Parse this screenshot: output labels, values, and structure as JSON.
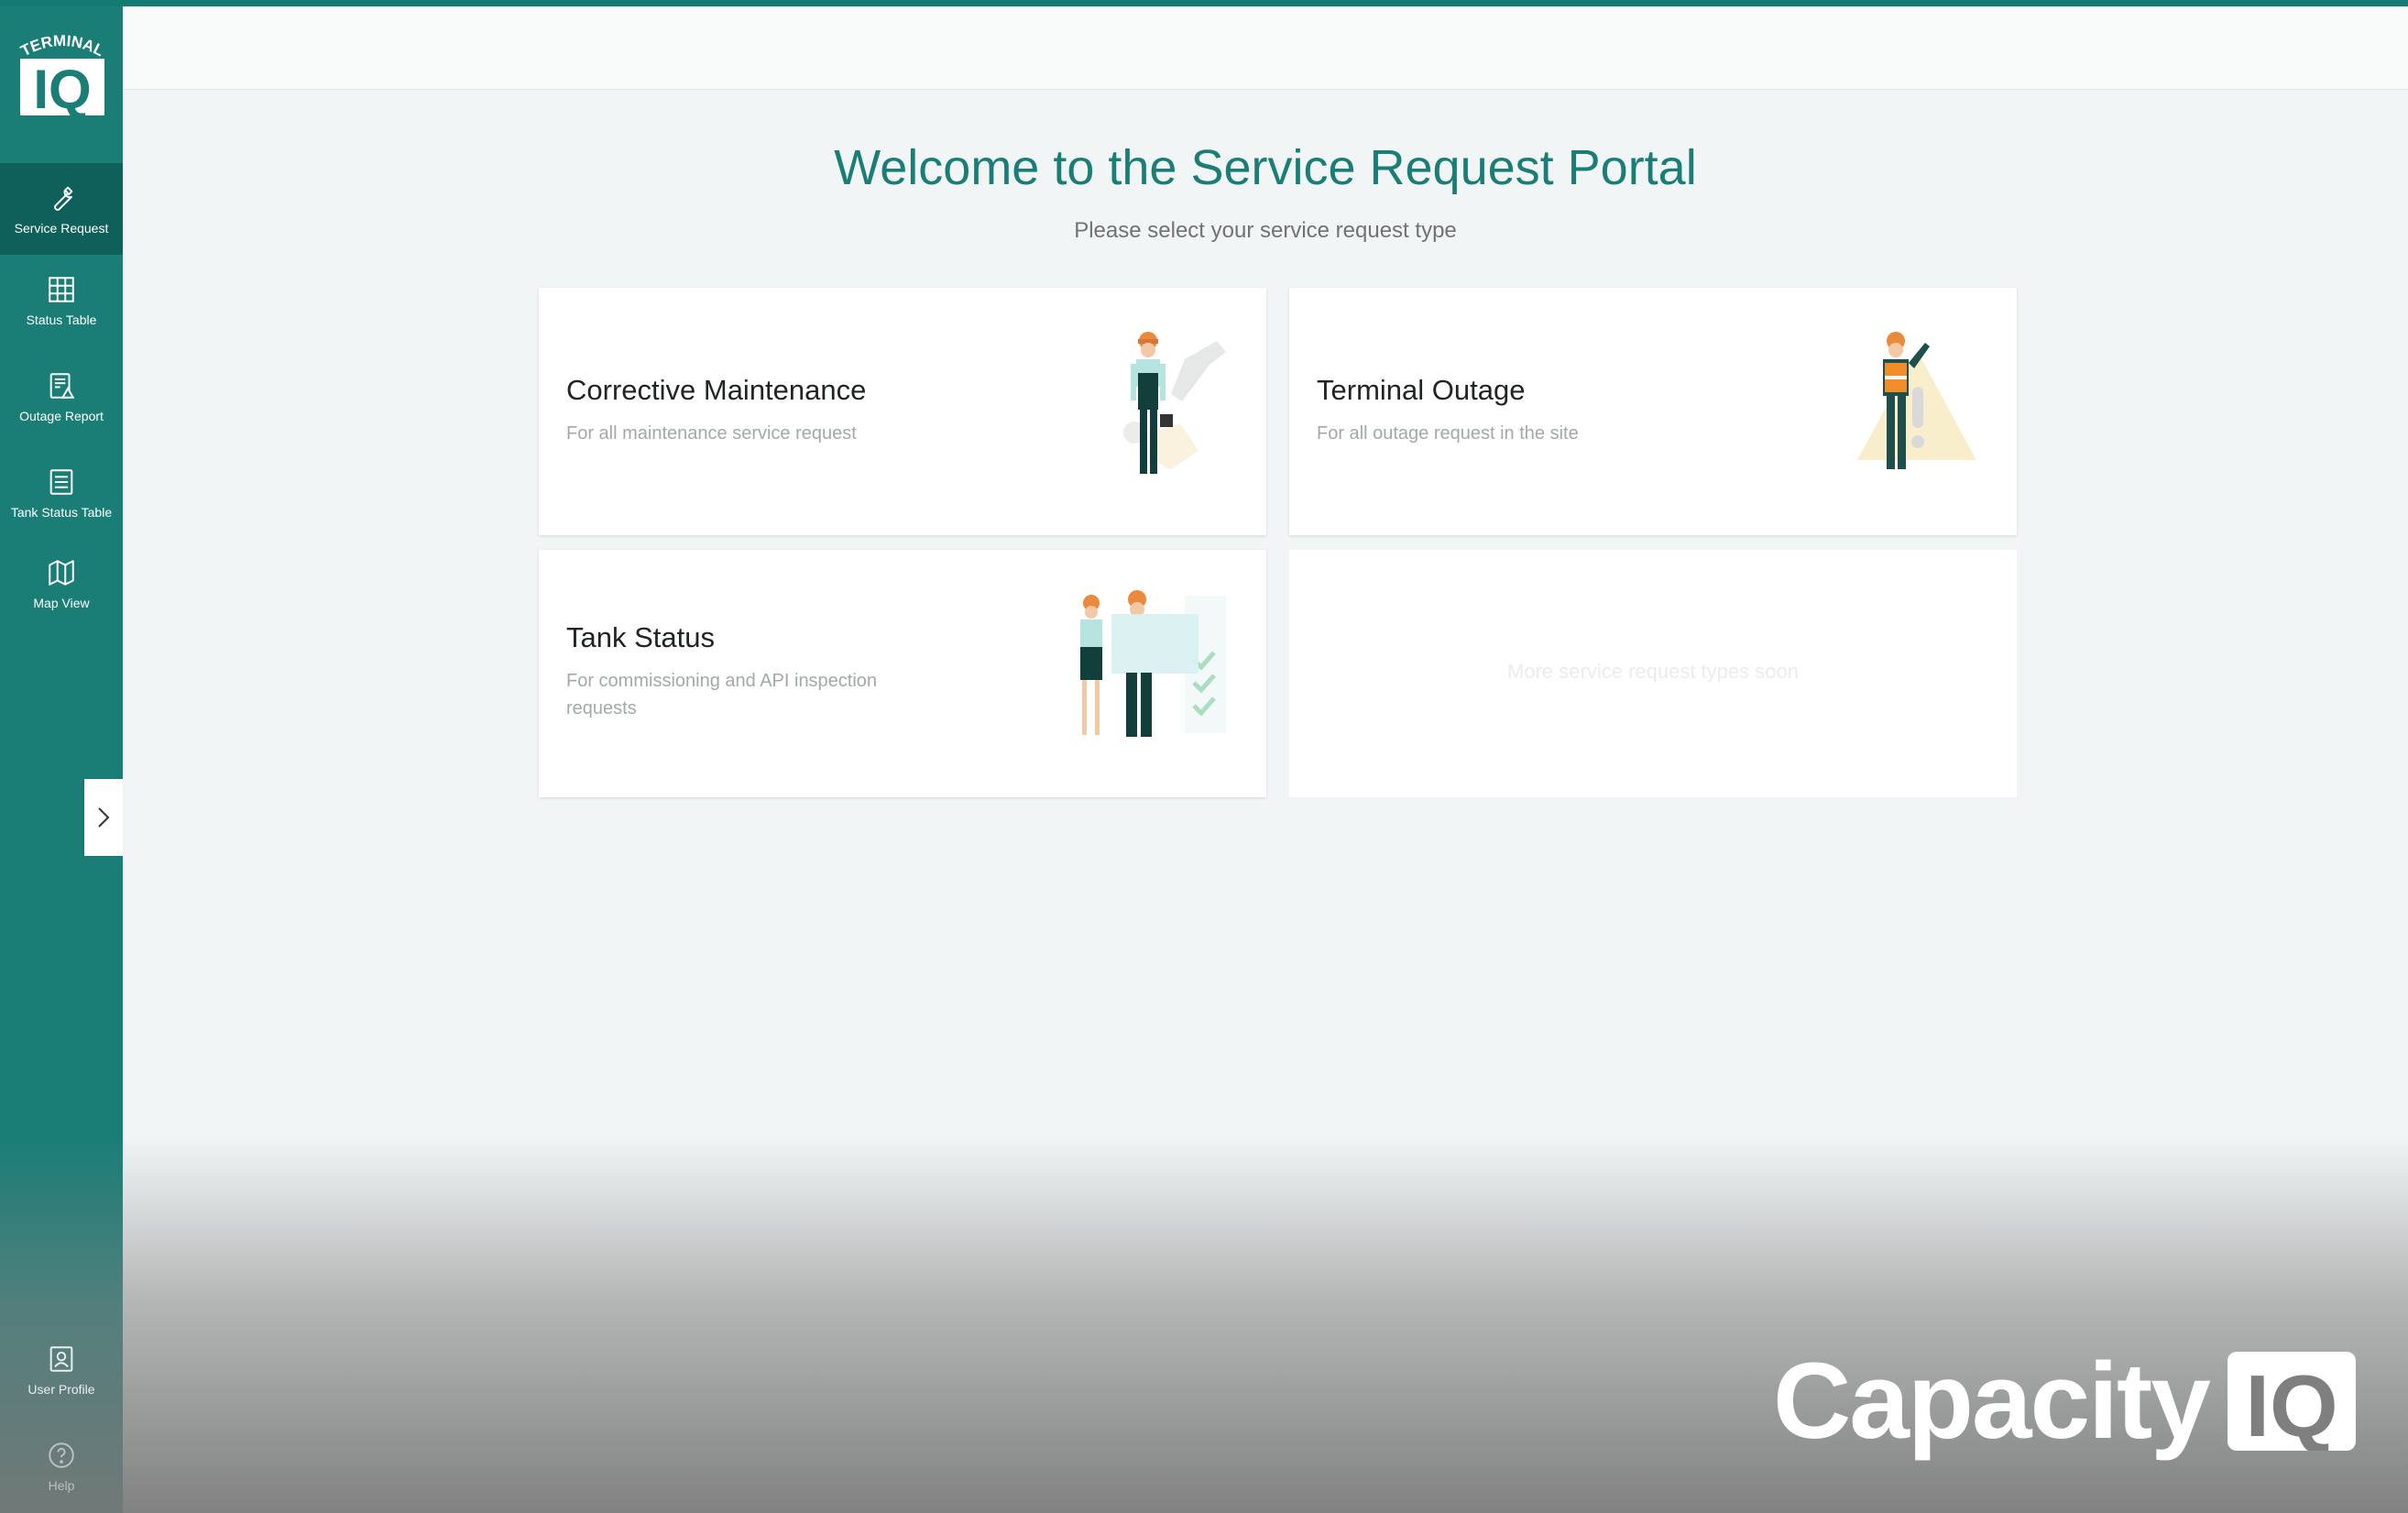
{
  "app": {
    "logo_top_text": "TERMINAL",
    "logo_main_text": "IQ",
    "accent_color": "#1a7e77",
    "active_color": "#0f5f5a"
  },
  "sidebar": {
    "items": [
      {
        "label": "Service Request",
        "icon": "wrench-icon",
        "active": true
      },
      {
        "label": "Status Table",
        "icon": "grid-icon",
        "active": false
      },
      {
        "label": "Outage Report",
        "icon": "report-warning-icon",
        "active": false
      },
      {
        "label": "Tank Status Table",
        "icon": "list-icon",
        "active": false
      },
      {
        "label": "Map View",
        "icon": "map-icon",
        "active": false
      }
    ],
    "bottom_items": [
      {
        "label": "User Profile",
        "icon": "user-profile-icon"
      },
      {
        "label": "Help",
        "icon": "help-icon"
      }
    ],
    "expand_icon": "chevron-right-icon"
  },
  "main": {
    "title": "Welcome to the Service Request Portal",
    "subtitle": "Please select your service request type",
    "cards": [
      {
        "title": "Corrective Maintenance",
        "description": "For all maintenance service request",
        "illustration": "maintenance-worker-illustration"
      },
      {
        "title": "Terminal Outage",
        "description": "For all outage request in the site",
        "illustration": "outage-warning-illustration"
      },
      {
        "title": "Tank Status",
        "description": "For commissioning and API inspection requests",
        "illustration": "inspection-team-illustration"
      }
    ],
    "placeholder_text": "More service request types soon"
  },
  "branding": {
    "word": "Capacity",
    "mark": "IQ"
  }
}
